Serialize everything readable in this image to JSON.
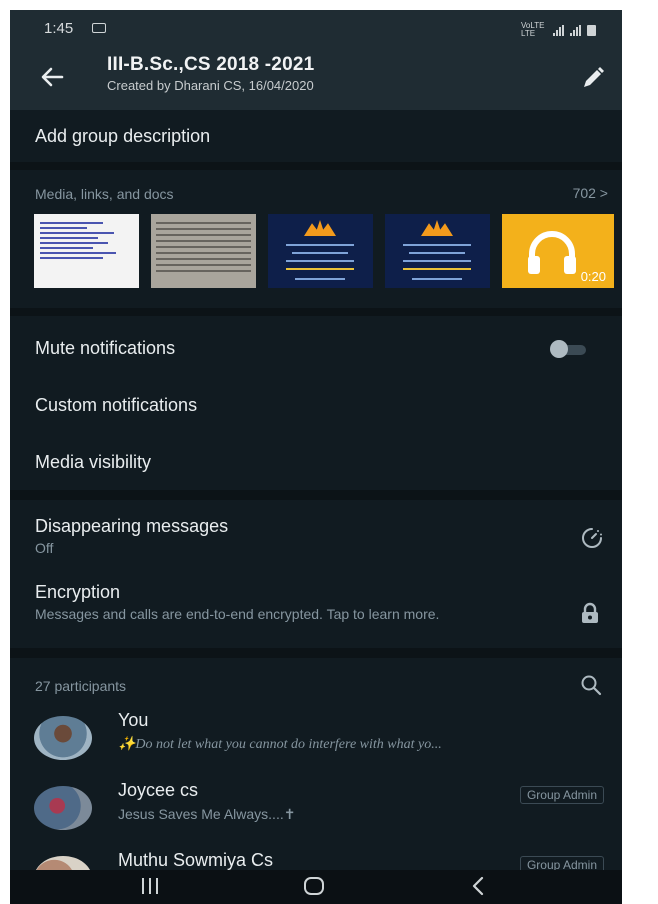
{
  "status_bar": {
    "time": "1:45",
    "network_label": "VoLTE LTE"
  },
  "header": {
    "title": "III-B.Sc.,CS 2018 -2021",
    "subtitle": "Created by Dharani CS, 16/04/2020"
  },
  "description": {
    "label": "Add group description"
  },
  "media": {
    "label": "Media, links, and docs",
    "count": "702 >",
    "audio_duration": "0:20"
  },
  "notifications": {
    "mute_label": "Mute notifications",
    "mute_on": false,
    "custom_label": "Custom notifications",
    "visibility_label": "Media visibility"
  },
  "privacy": {
    "disappearing_label": "Disappearing messages",
    "disappearing_value": "Off",
    "encryption_label": "Encryption",
    "encryption_desc": "Messages and calls are end-to-end encrypted. Tap to learn more."
  },
  "participants": {
    "count_label": "27 participants",
    "list": [
      {
        "name": "You",
        "about": "✨Do not let what you cannot do interfere with what yo...",
        "badge": ""
      },
      {
        "name": "Joycee cs",
        "about": "Jesus Saves Me Always....✝",
        "badge": "Group Admin"
      },
      {
        "name": "Muthu Sowmiya Cs",
        "about": "",
        "badge": "Group Admin"
      }
    ]
  },
  "colors": {
    "background": "#111b21",
    "header": "#1f2c33",
    "accent": "#00a884",
    "secondary_text": "#8696a0"
  },
  "icons": [
    "back-arrow-icon",
    "edit-pencil-icon",
    "timer-icon",
    "lock-icon",
    "search-icon",
    "headphones-icon"
  ]
}
